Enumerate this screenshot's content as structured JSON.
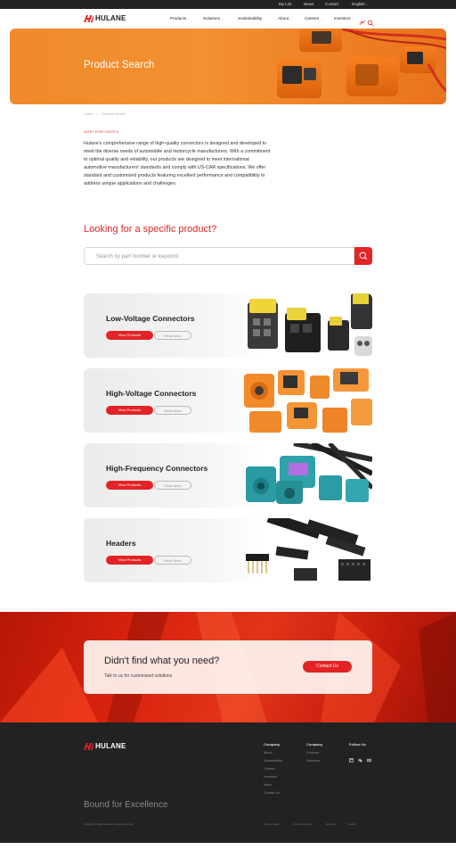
{
  "utility_bar": {
    "my_list": "My List",
    "news": "News",
    "contact": "Contact",
    "language": "English"
  },
  "header": {
    "brand": "HULANE",
    "nav": [
      "Products",
      "Solutions",
      "Sustainability",
      "About",
      "Careers",
      "Investors"
    ]
  },
  "hero": {
    "title": "Product Search"
  },
  "breadcrumb": {
    "home": "Home",
    "separator": ">",
    "current": "Product Search"
  },
  "intro": {
    "eyebrow": "ENTRY POINT/SEARCH",
    "paragraph": "Hulane's comprehensive range of high-quality connectors is designed and developed to meet the diverse needs of automobile and motorcycle manufacturers. With a commitment to optimal quality and reliability, our products are designed to meet international automotive manufacturers' standards and comply with US-CAR specifications. We offer standard and customized products featuring excellent performance and compatibility to address unique applications and challenges."
  },
  "search": {
    "title": "Looking for a specific product?",
    "placeholder": "Search by part number or keyword"
  },
  "products": [
    {
      "title": "Low-Voltage Connectors",
      "view": "View Products",
      "more": "Read More"
    },
    {
      "title": "High-Voltage Connectors",
      "view": "View Products",
      "more": "Read More"
    },
    {
      "title": "High-Frequency Connectors",
      "view": "View Products",
      "more": "Read More"
    },
    {
      "title": "Headers",
      "view": "View Products",
      "more": "Read More"
    }
  ],
  "cta": {
    "title": "Didn't find what you need?",
    "subtitle": "Talk to us for customized solutions",
    "button": "Contact Us"
  },
  "footer": {
    "brand": "HULANE",
    "company_heading": "Company",
    "company_links": [
      "About",
      "Sustainability",
      "Careers",
      "Investors",
      "News",
      "Contact Us"
    ],
    "products_heading": "Company",
    "products_links": [
      "Products",
      "Solutions"
    ],
    "follow_heading": "Follow Us",
    "slogan": "Bound for Excellence",
    "copyright": "Copyright © 2024 Hulane. All rights reserved.",
    "legal_links": [
      "Privacy Policy",
      "Terms of Service",
      "Sitemap",
      "Cookies"
    ]
  },
  "colors": {
    "brand_red": "#e32325",
    "hero_orange": "#f08a2c",
    "footer_bg": "#222222"
  }
}
